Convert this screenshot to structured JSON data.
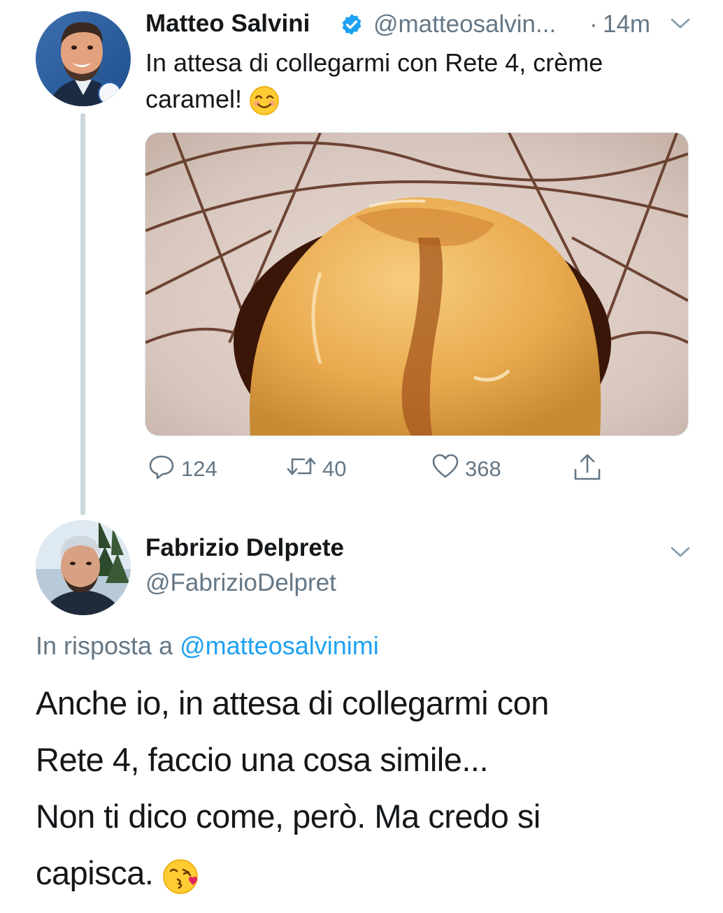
{
  "tweet": {
    "author_name": "Matteo Salvini",
    "verified_icon": "verified-badge-icon",
    "handle": "@matteosalvin...",
    "separator": "·",
    "time": "14m",
    "menu_icon": "chevron-down-icon",
    "text": "In attesa di collegarmi con Rete 4, crème caramel!",
    "emoji": "smiling-face-icon",
    "image_icon": "creme-caramel-photo",
    "actions": {
      "reply_count": "124",
      "retweet_count": "40",
      "like_count": "368"
    }
  },
  "reply": {
    "author_name": "Fabrizio Delprete",
    "handle": "@FabrizioDelpret",
    "menu_icon": "chevron-down-icon",
    "in_reply_prefix": "In risposta a",
    "in_reply_handle": "@matteosalvinimi",
    "lines": [
      "Anche io, in attesa di collegarmi con",
      "Rete 4, faccio una cosa simile...",
      "Non ti dico come, però. Ma credo si",
      "capisca."
    ],
    "emoji": "face-blowing-kiss-icon"
  },
  "colors": {
    "text": "#14171a",
    "muted": "#657786",
    "link": "#1da1f2",
    "thread_line": "#ccd6dd",
    "verified": "#1da1f2"
  }
}
